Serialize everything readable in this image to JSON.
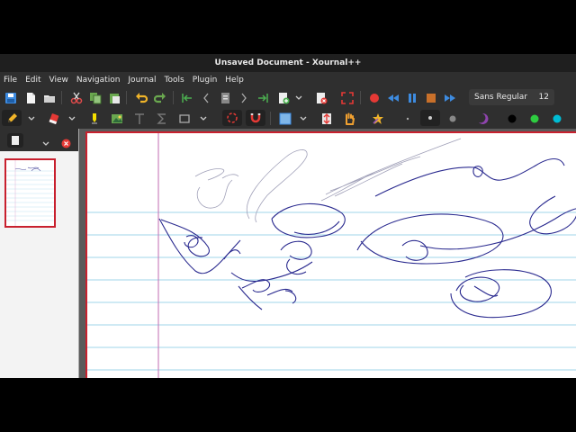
{
  "window": {
    "title": "Unsaved Document - Xournal++"
  },
  "menu": [
    "File",
    "Edit",
    "View",
    "Navigation",
    "Journal",
    "Tools",
    "Plugin",
    "Help"
  ],
  "toolbar": {
    "font_name": "Sans Regular",
    "font_size": "12"
  },
  "colors": {
    "accent": "#c8202e",
    "ink": "#2a2a8f",
    "rule": "#9fd6ea",
    "margin": "#c06bb0"
  },
  "icons": {
    "row1": [
      "save-icon",
      "new-doc-icon",
      "open-icon",
      "cut-icon",
      "copy-icon",
      "paste-icon",
      "undo-icon",
      "redo-icon",
      "first-page-icon",
      "prev-page-icon",
      "goto-page-icon",
      "next-page-icon",
      "last-page-icon",
      "insert-page-icon",
      "delete-page-icon",
      "fullscreen-icon",
      "record-icon",
      "rewind-icon",
      "pause-icon",
      "stop-icon",
      "fast-forward-icon"
    ],
    "row2": [
      "pen-icon",
      "eraser-icon",
      "highlighter-icon",
      "image-icon",
      "text-icon",
      "math-icon",
      "rectangle-icon",
      "lasso-select-icon",
      "magnet-icon",
      "region-select-icon",
      "vertical-space-icon",
      "hand-icon",
      "default-tool-icon",
      "fine-dot",
      "medium-dot",
      "thick-dot",
      "purple-color",
      "black-color",
      "green-color",
      "cyan-color"
    ]
  }
}
